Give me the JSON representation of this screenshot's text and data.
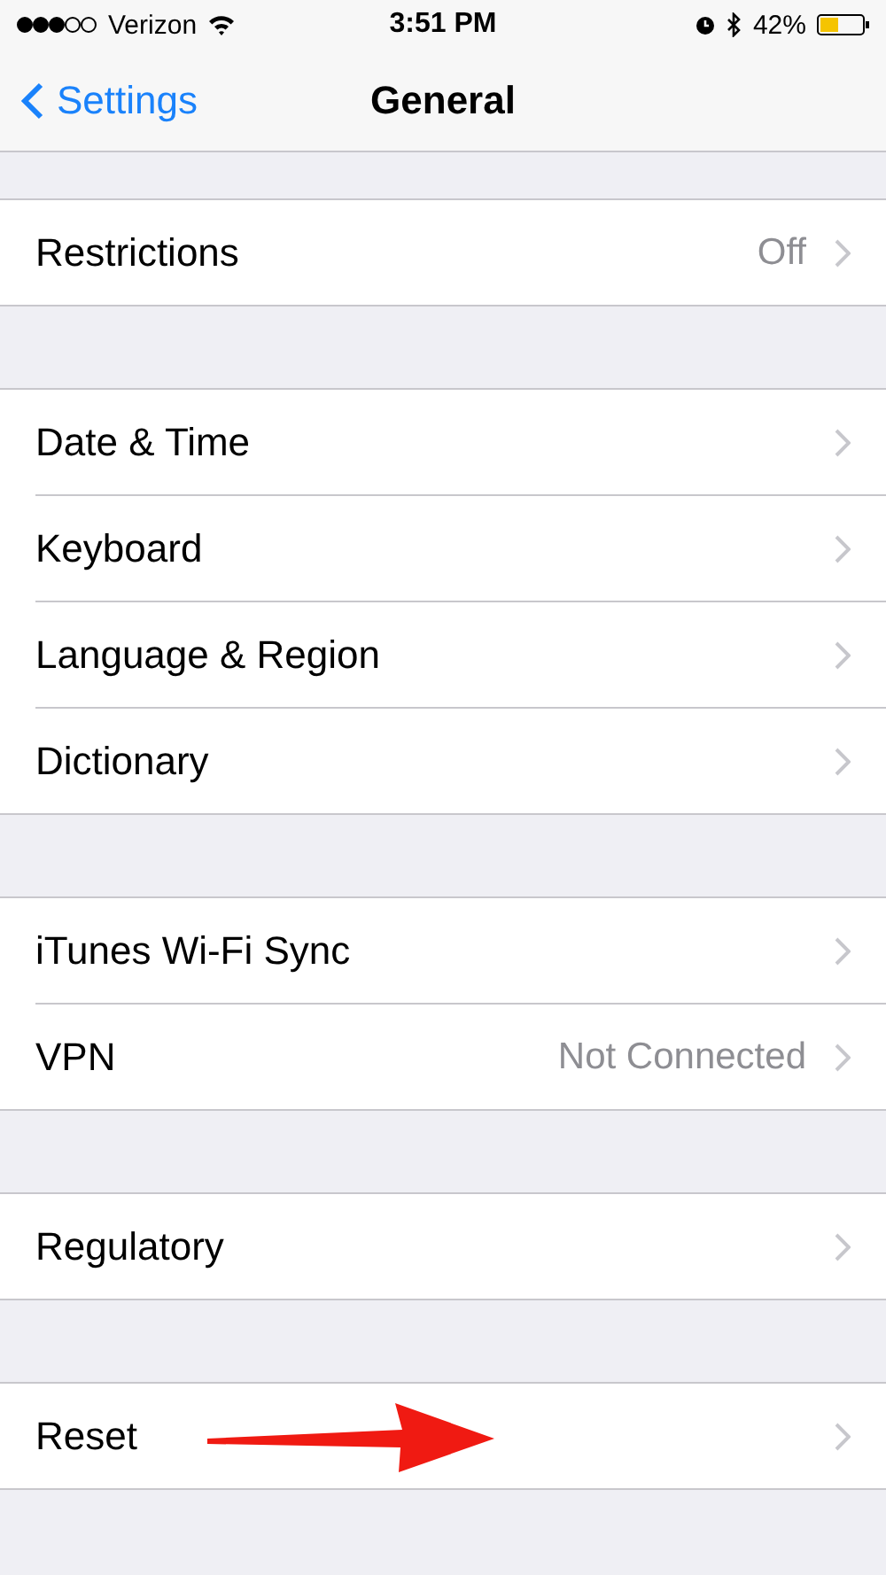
{
  "status_bar": {
    "carrier": "Verizon",
    "time": "3:51 PM",
    "battery": "42%"
  },
  "nav": {
    "back": "Settings",
    "title": "General"
  },
  "sections": [
    {
      "rows": [
        {
          "label": "Restrictions",
          "value": "Off"
        }
      ]
    },
    {
      "rows": [
        {
          "label": "Date & Time"
        },
        {
          "label": "Keyboard"
        },
        {
          "label": "Language & Region"
        },
        {
          "label": "Dictionary"
        }
      ]
    },
    {
      "rows": [
        {
          "label": "iTunes Wi-Fi Sync"
        },
        {
          "label": "VPN",
          "value": "Not Connected"
        }
      ]
    },
    {
      "rows": [
        {
          "label": "Regulatory"
        }
      ]
    },
    {
      "rows": [
        {
          "label": "Reset",
          "annotated": true
        }
      ]
    }
  ]
}
